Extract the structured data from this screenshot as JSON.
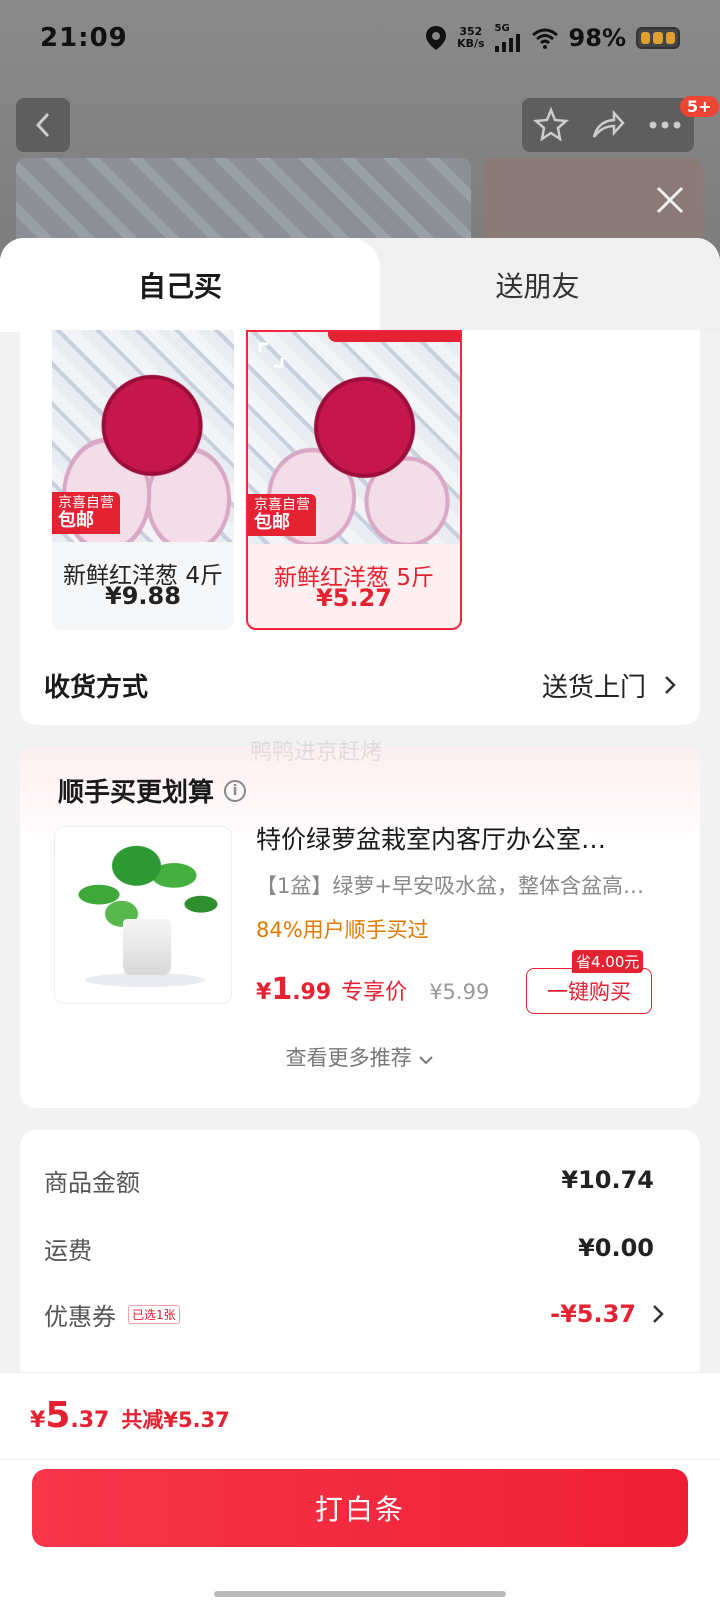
{
  "status_bar": {
    "time": "21:09",
    "net_speed_value": "352",
    "net_speed_unit": "KB/s",
    "network": "5G",
    "battery": "98%"
  },
  "header": {
    "badge": "5+"
  },
  "tabs": [
    {
      "label": "自己买",
      "active": true
    },
    {
      "label": "送朋友",
      "active": false
    }
  ],
  "variants": [
    {
      "tag_line1": "京喜自营",
      "tag_line2": "包邮",
      "name": "新鲜红洋葱 4斤",
      "price": "¥9.88",
      "selected": false
    },
    {
      "tag_line1": "京喜自营",
      "tag_line2": "包邮",
      "name": "新鲜红洋葱 5斤",
      "price": "¥5.27",
      "selected": true
    }
  ],
  "delivery": {
    "label": "收货方式",
    "value": "送货上门"
  },
  "watermark": "鸭鸭进京赶烤",
  "recommendation": {
    "title": "顺手买更划算",
    "product_name": "特价绿萝盆栽室内客厅办公室…",
    "product_desc": "【1盆】绿萝+早安吸水盆，整体含盆高…",
    "hint": "84%用户顺手买过",
    "price_symbol": "¥",
    "price_int": "1",
    "price_dec": ".99",
    "exclusive_label": "专享价",
    "original_price": "¥5.99",
    "save_tag": "省4.00元",
    "buy_label": "一键购买",
    "more_label": "查看更多推荐"
  },
  "summary": {
    "goods_label": "商品金额",
    "goods_value": "¥10.74",
    "shipping_label": "运费",
    "shipping_value": "¥0.00",
    "coupon_label": "优惠券",
    "coupon_tag": "已选1张",
    "coupon_value": "-¥5.37"
  },
  "footer": {
    "total_symbol": "¥",
    "total_int": "5",
    "total_dec": ".37",
    "reduce": "共减¥5.37",
    "pay_label": "打白条"
  },
  "colors": {
    "accent": "#e52231",
    "hint": "#e07b00",
    "pay_button": "#f7364a"
  }
}
